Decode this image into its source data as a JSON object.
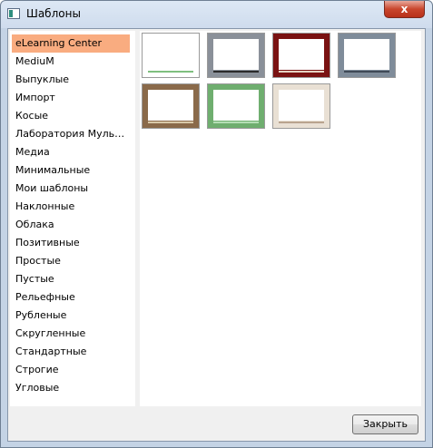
{
  "window": {
    "title": "Шаблоны"
  },
  "icons": {
    "app": "template-window-icon",
    "close": "close-icon"
  },
  "title_close_glyph": "x",
  "sidebar": {
    "items": [
      {
        "label": "eLearning Center",
        "selected": true
      },
      {
        "label": "MediuM"
      },
      {
        "label": "Выпуклые"
      },
      {
        "label": "Импорт"
      },
      {
        "label": "Косые"
      },
      {
        "label": "Лаборатория Мульти..."
      },
      {
        "label": "Медиа"
      },
      {
        "label": "Минимальные"
      },
      {
        "label": "Мои шаблоны"
      },
      {
        "label": "Наклонные"
      },
      {
        "label": "Облака"
      },
      {
        "label": "Позитивные"
      },
      {
        "label": "Простые"
      },
      {
        "label": "Пустые"
      },
      {
        "label": "Рельефные"
      },
      {
        "label": "Рубленые"
      },
      {
        "label": "Скругленные"
      },
      {
        "label": "Стандартные"
      },
      {
        "label": "Строгие"
      },
      {
        "label": "Угловые"
      }
    ]
  },
  "templates": [
    {
      "name": "template-thumb-1",
      "frame": "#ffffff",
      "accent": "#7fbf7f"
    },
    {
      "name": "template-thumb-2",
      "frame": "#8a9099",
      "accent": "#2b2b2b"
    },
    {
      "name": "template-thumb-3",
      "frame": "#7a1212",
      "accent": "#e6d3c3"
    },
    {
      "name": "template-thumb-4",
      "frame": "#7f8c9a",
      "accent": "#3f4a57"
    },
    {
      "name": "template-thumb-5",
      "frame": "#8a6a4a",
      "accent": "#d9c9a9"
    },
    {
      "name": "template-thumb-6",
      "frame": "#6fae6f",
      "accent": "#b5deb5"
    },
    {
      "name": "template-thumb-7",
      "frame": "#e9e0d4",
      "accent": "#b9a48f"
    }
  ],
  "buttons": {
    "close_label": "Закрыть"
  },
  "colors": {
    "selection": "#f9ac80",
    "title_close": "#c9462d"
  }
}
